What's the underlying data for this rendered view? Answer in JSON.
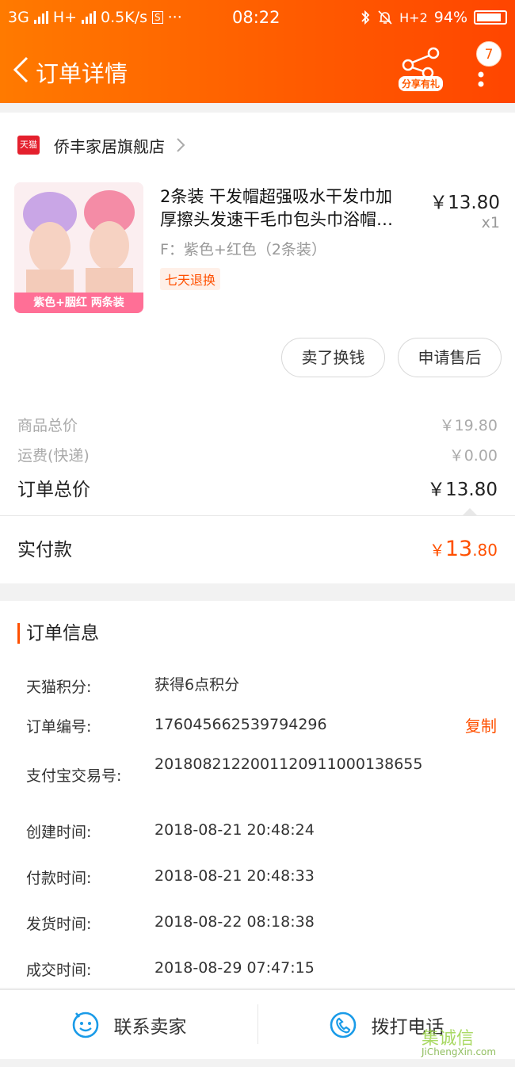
{
  "status_bar": {
    "network_1": "3G",
    "network_2": "H+",
    "speed": "0.5K/s",
    "sim_icon": "S",
    "dots": "···",
    "time": "08:22",
    "network_3": "H+2",
    "battery": "94%"
  },
  "navbar": {
    "title": "订单详情",
    "share_label": "分享有礼",
    "badge_count": "7"
  },
  "shop": {
    "logo_text": "天猫",
    "name": "侨丰家居旗舰店"
  },
  "product": {
    "title_line1": "2条装 干发帽超强吸水干发巾加",
    "title_line2": "厚擦头发速干毛巾包头巾浴帽…",
    "price": "￥13.80",
    "qty": "x1",
    "sku": "F：紫色+红色（2条装）",
    "tag": "七天退换",
    "image_caption": "紫色+胭红 两条装"
  },
  "actions": {
    "sell_label": "卖了换钱",
    "after_sale_label": "申请售后"
  },
  "summary": {
    "goods_total_label": "商品总价",
    "goods_total_value": "￥19.80",
    "shipping_label": "运费(快递)",
    "shipping_value": "￥0.00",
    "order_total_label": "订单总价",
    "order_total_value": "￥13.80",
    "paid_label": "实付款",
    "paid_currency": "￥",
    "paid_int": "13",
    "paid_dec": ".80"
  },
  "order_info": {
    "title": "订单信息",
    "copy_label": "复制",
    "rows": [
      {
        "k": "天猫积分:",
        "v": "获得6点积分"
      },
      {
        "k": "订单编号:",
        "v": "176045662539794296"
      },
      {
        "k": "支付宝交易号:",
        "v": "2018082122001120911000138655"
      },
      {
        "k": "创建时间:",
        "v": "2018-08-21 20:48:24"
      },
      {
        "k": "付款时间:",
        "v": "2018-08-21 20:48:33"
      },
      {
        "k": "发货时间:",
        "v": "2018-08-22 08:18:38"
      },
      {
        "k": "成交时间:",
        "v": "2018-08-29 07:47:15"
      }
    ]
  },
  "bottom_bar": {
    "contact_label": "联系卖家",
    "call_label": "拨打电话"
  },
  "watermark": {
    "text": "集诚信",
    "sub": "JiChengXin.com"
  }
}
